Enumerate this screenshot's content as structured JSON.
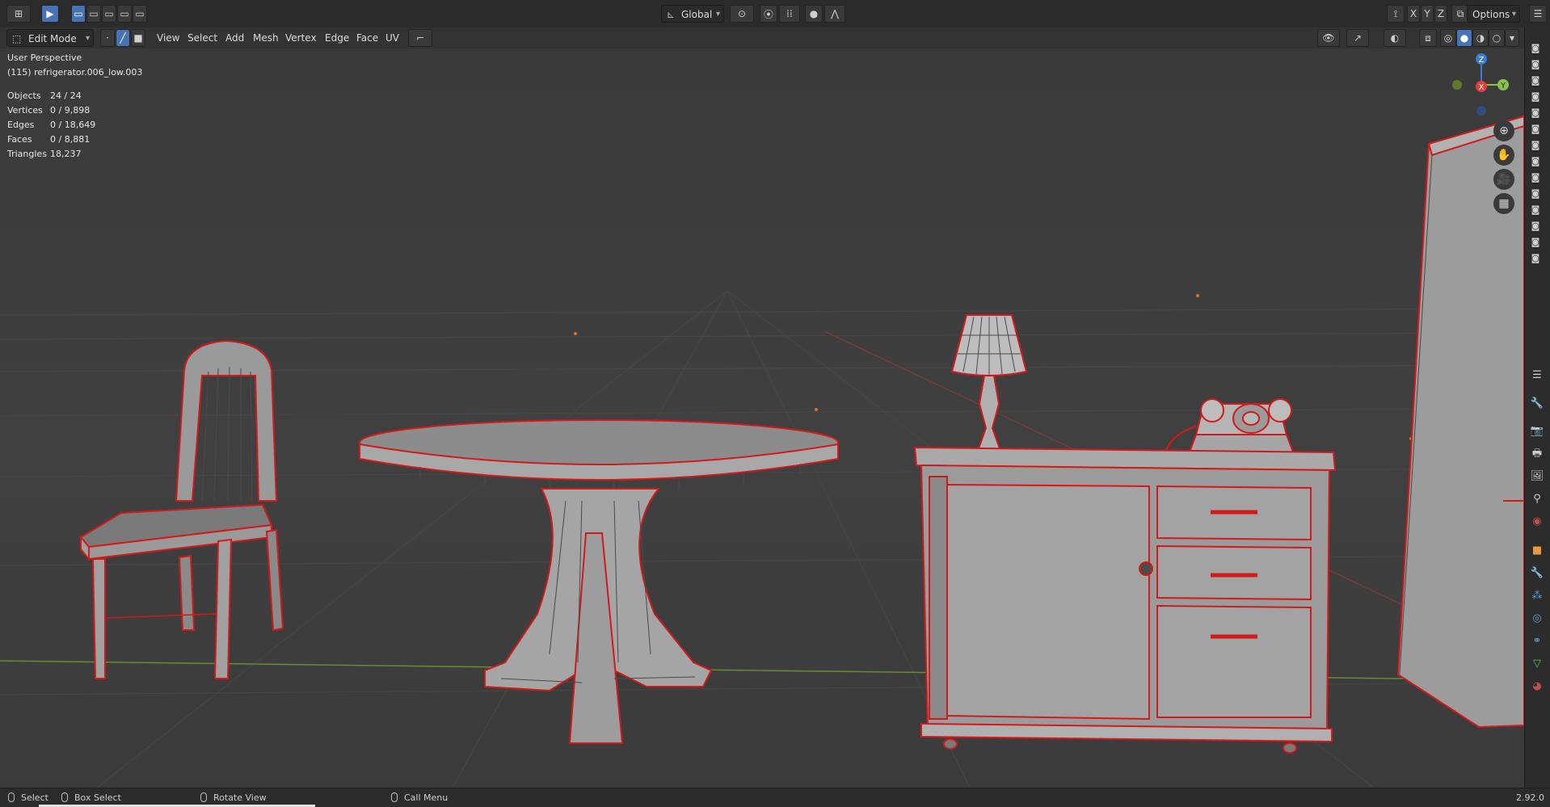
{
  "topbar": {
    "transform_orientation": "Global",
    "options_label": "Options",
    "axis_x": "X",
    "axis_y": "Y",
    "axis_z": "Z"
  },
  "header": {
    "mode": "Edit Mode",
    "menus": [
      "View",
      "Select",
      "Add",
      "Mesh",
      "Vertex",
      "Edge",
      "Face",
      "UV"
    ]
  },
  "viewport": {
    "view_name": "User Perspective",
    "object_name": "(115) refrigerator.006_low.003",
    "stats": [
      {
        "label": "Objects",
        "value": "24 / 24"
      },
      {
        "label": "Vertices",
        "value": "0 / 9,898"
      },
      {
        "label": "Edges",
        "value": "0 / 18,649"
      },
      {
        "label": "Faces",
        "value": "0 / 8,881"
      },
      {
        "label": "Triangles",
        "value": "18,237"
      }
    ],
    "gizmo": {
      "x": "X",
      "y": "Y",
      "z": "Z"
    }
  },
  "statusbar": {
    "select": "Select",
    "box_select": "Box Select",
    "rotate_view": "Rotate View",
    "call_menu": "Call Menu",
    "version": "2.92.0"
  },
  "colors": {
    "edge_highlight": "#d11a1a",
    "gizmo_x": "#e23d3d",
    "gizmo_y": "#8bc34a",
    "gizmo_z": "#3a7bd5",
    "active_button": "#4772b3"
  }
}
